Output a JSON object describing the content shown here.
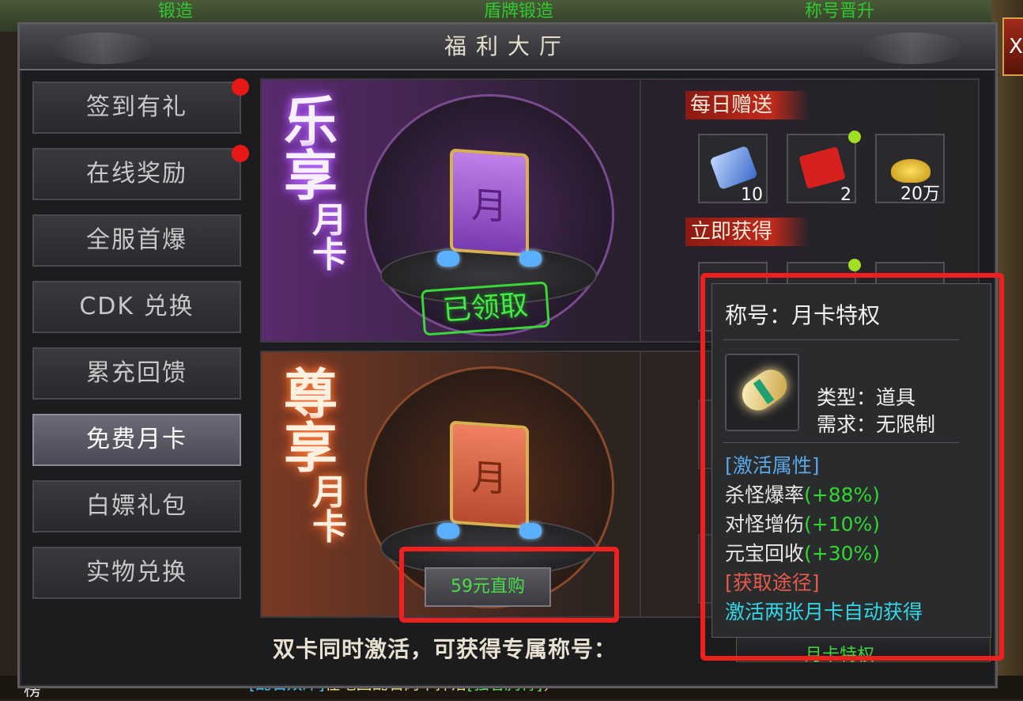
{
  "background": {
    "top_labels": [
      "锻造",
      "盾牌锻造",
      "称号晋升"
    ],
    "chat": {
      "part1": "[乱石双岸]",
      "part2": "在地图",
      "part3": "乱石岗",
      "part4": "中掉落",
      "part5": "[强者胸骨]",
      "part6": "，"
    },
    "rank_label": "榜",
    "close_label": "X"
  },
  "window": {
    "title": "福利大厅"
  },
  "sidebar": {
    "items": [
      {
        "label": "签到有礼",
        "badge": true
      },
      {
        "label": "在线奖励",
        "badge": true
      },
      {
        "label": "全服首爆",
        "badge": false
      },
      {
        "label": "CDK 兑换",
        "badge": false
      },
      {
        "label": "累充回馈",
        "badge": false
      },
      {
        "label": "免费月卡",
        "badge": false,
        "active": true
      },
      {
        "label": "白嫖礼包",
        "badge": false
      },
      {
        "label": "实物兑换",
        "badge": false
      }
    ]
  },
  "card_purple": {
    "title_big": [
      "乐",
      "享"
    ],
    "title_small": [
      "月",
      "卡"
    ],
    "card_char": "月",
    "status_stamp": "已领取",
    "daily_label": "每日赠送",
    "instant_label": "立即获得",
    "daily_items": [
      {
        "icon": "blue-crystal-icon",
        "count": "10"
      },
      {
        "icon": "red-envelope-icon",
        "count": "2",
        "dot": true
      },
      {
        "icon": "gold-ingot-icon",
        "count": "20万"
      }
    ]
  },
  "card_orange": {
    "title_big": [
      "尊",
      "享"
    ],
    "title_small": [
      "月",
      "卡"
    ],
    "card_char": "月",
    "buy_label": "59元直购"
  },
  "bottom": {
    "text": "双卡同时激活，可获得专属称号：",
    "title_peek": "月卡特权"
  },
  "tooltip": {
    "heading": "称号：月卡特权",
    "type": "类型：道具",
    "requirement": "需求：无限制",
    "attr_header": "[激活属性]",
    "attrs": [
      {
        "name": "杀怪爆率",
        "value": "(+88%)"
      },
      {
        "name": "对怪增伤",
        "value": "(+10%)"
      },
      {
        "name": "元宝回收",
        "value": "(+30%)"
      }
    ],
    "source_header": "[获取途径]",
    "source_text": "激活两张月卡自动获得"
  },
  "colors": {
    "highlight": "#f02020",
    "attr_green": "#2ed82e",
    "header_blue": "#5aa8e8",
    "header_red": "#e85a4a",
    "source_cyan": "#32d8e8"
  }
}
